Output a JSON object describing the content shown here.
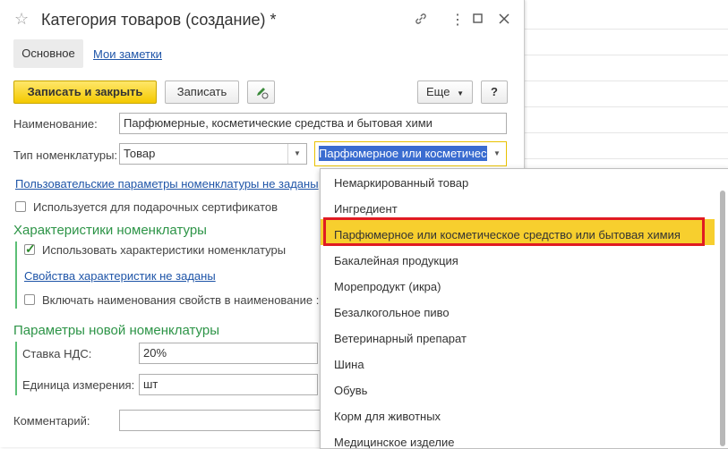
{
  "window": {
    "title": "Категория товаров (создание) *",
    "tabs": [
      {
        "label": "Основное"
      },
      {
        "label": "Мои заметки"
      }
    ]
  },
  "toolbar": {
    "save_close_label": "Записать и закрыть",
    "save_label": "Записать",
    "more_label": "Еще",
    "help_label": "?"
  },
  "form": {
    "name_label": "Наименование:",
    "name_value": "Парфюмерные, косметические средства и бытовая хими",
    "type_label": "Тип номенклатуры:",
    "type_value": "Товар",
    "subtype_value": "Парфюмерное или косметичес",
    "custom_params_link": "Пользовательские параметры номенклатуры не заданы",
    "gift_cert_label": "Используется для подарочных сертификатов",
    "characteristics_title": "Характеристики номенклатуры",
    "use_characteristics_label": "Использовать характеристики номенклатуры",
    "char_props_link": "Свойства характеристик не заданы",
    "include_props_label": "Включать наименования свойств в наименование :",
    "new_params_title": "Параметры новой номенклатуры",
    "vat_label": "Ставка НДС:",
    "vat_value": "20%",
    "unit_label": "Единица измерения:",
    "unit_value": "шт",
    "comment_label": "Комментарий:",
    "comment_value": ""
  },
  "dropdown": {
    "items": [
      "Немаркированный товар",
      "Ингредиент",
      "Парфюмерное или косметическое средство или бытовая химия",
      "Бакалейная продукция",
      "Морепродукт (икра)",
      "Безалкогольное пиво",
      "Ветеринарный препарат",
      "Шина",
      "Обувь",
      "Корм для животных",
      "Медицинское изделие"
    ],
    "selected_index": 2
  },
  "colors": {
    "accent_green": "#2d9447",
    "link_blue": "#1f55a8",
    "highlight_yellow": "#f7cf2e",
    "highlight_border_red": "#e01b22"
  },
  "icons": [
    "star-icon",
    "link-icon",
    "more-vertical-icon",
    "maximize-icon",
    "close-icon",
    "edit-pen-icon",
    "chevron-down-icon"
  ]
}
